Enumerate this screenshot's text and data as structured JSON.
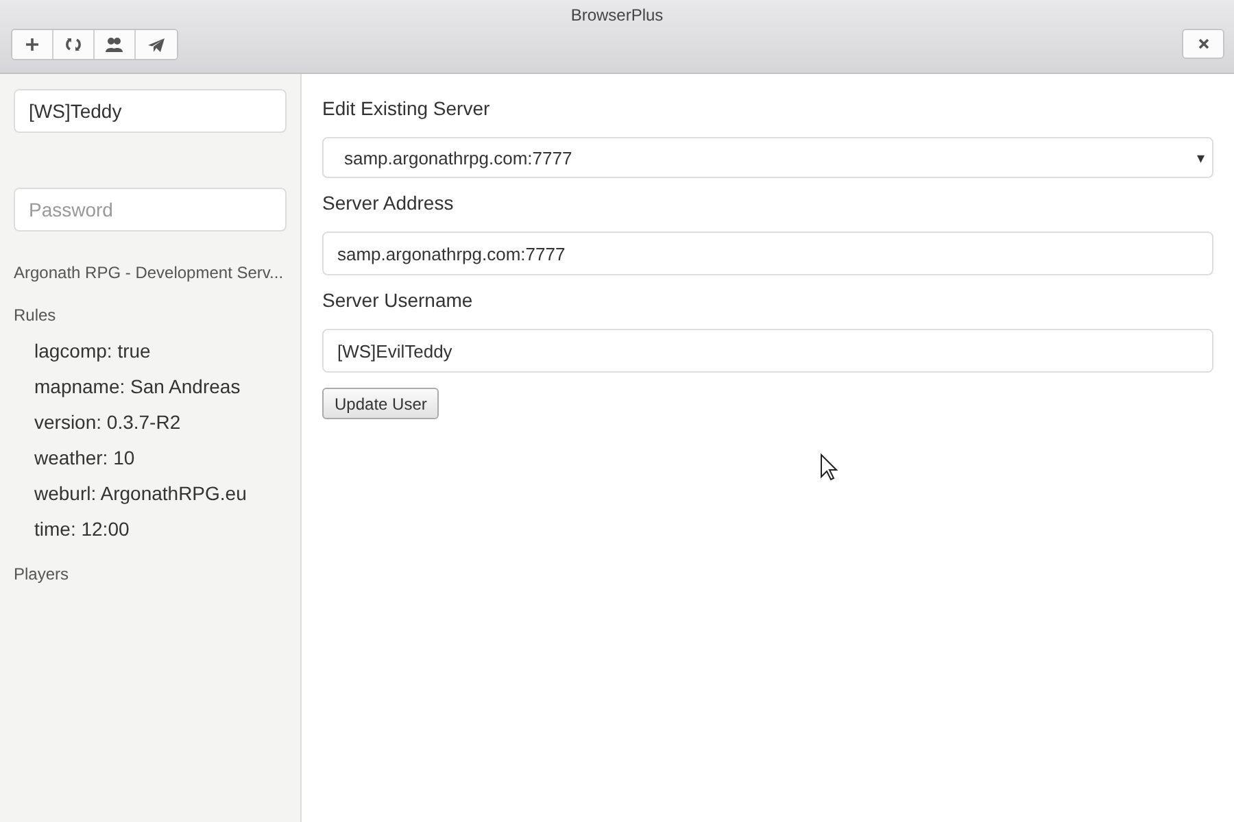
{
  "window": {
    "title": "BrowserPlus"
  },
  "toolbar": {
    "buttons": [
      {
        "kind": "add"
      },
      {
        "kind": "refresh"
      },
      {
        "kind": "users"
      },
      {
        "kind": "send"
      }
    ],
    "close": {
      "kind": "close"
    }
  },
  "sidebar": {
    "username": {
      "value": "[WS]Teddy"
    },
    "password": {
      "placeholder": "Password"
    },
    "server_name": "Argonath RPG - Development Serv...",
    "rules_heading": "Rules",
    "rules": [
      "lagcomp: true",
      "mapname: San Andreas",
      "version: 0.3.7-R2",
      "weather: 10",
      "weburl: ArgonathRPG.eu",
      "time: 12:00"
    ],
    "players_heading": "Players"
  },
  "form": {
    "select_label": "Edit Existing Server",
    "select_value": "samp.argonathrpg.com:7777",
    "select_caret": "▾",
    "address_label": "Server Address",
    "address_value": "samp.argonathrpg.com:7777",
    "username_label": "Server Username",
    "username_value": "[WS]EvilTeddy",
    "submit": "Update User"
  }
}
